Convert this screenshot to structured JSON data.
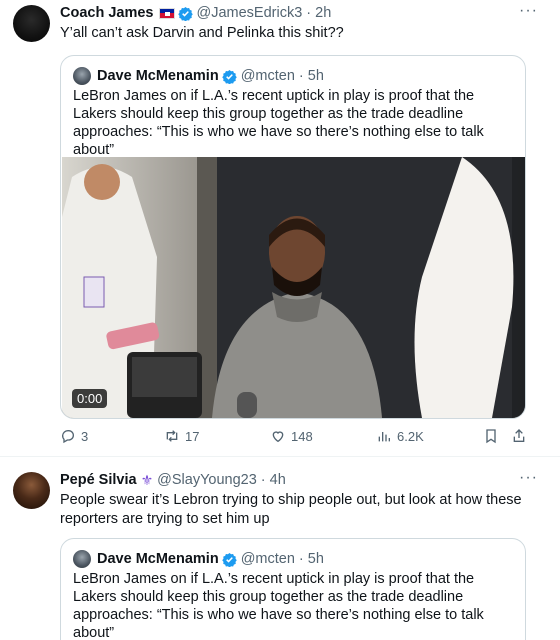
{
  "tweets": [
    {
      "author_name": "Coach James",
      "handle": "@JamesEdrick3",
      "time": "2h",
      "text": "Y’all can’t ask Darvin and Pelinka this shit??",
      "quote": {
        "author_name": "Dave McMenamin",
        "handle": "@mcten",
        "time": "5h",
        "text": "LeBron James on if L.A.’s recent uptick in play is proof that the Lakers should keep this group together as the trade deadline approaches: “This is who we have so there’s nothing else to talk about”",
        "video_time": "0:00"
      },
      "stats": {
        "replies": "3",
        "retweets": "17",
        "likes": "148",
        "views": "6.2K"
      }
    },
    {
      "author_name": "Pepé Silvia",
      "handle": "@SlayYoung23",
      "time": "4h",
      "text": "People swear it’s Lebron trying to ship people out, but look at how these reporters are trying to set him up",
      "quote": {
        "author_name": "Dave McMenamin",
        "handle": "@mcten",
        "time": "5h",
        "text": "LeBron James on if L.A.’s recent uptick in play is proof that the Lakers should keep this group together as the trade deadline approaches: “This is who we have so there’s nothing else to talk about”"
      }
    }
  ],
  "colors": {
    "verified": "#1d9bf0",
    "secondary_text": "#536471",
    "border": "#cfd9de"
  },
  "icons": [
    "verified-badge-icon",
    "haiti-flag-icon",
    "fleur-de-lis-icon",
    "more-icon",
    "reply-icon",
    "retweet-icon",
    "like-icon",
    "views-icon",
    "bookmark-icon",
    "share-icon"
  ]
}
